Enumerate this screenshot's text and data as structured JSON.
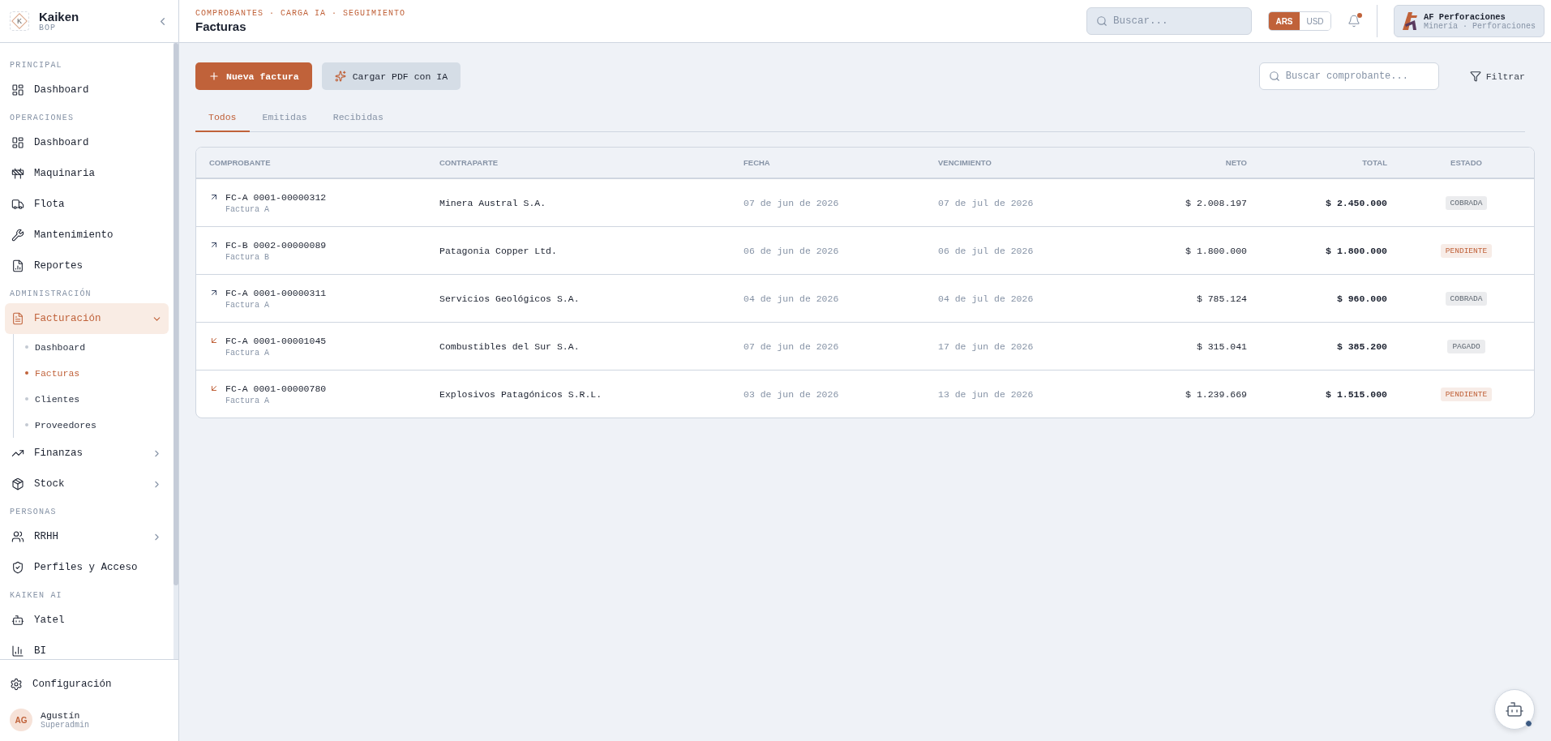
{
  "brand": {
    "logo_letter": "K",
    "name": "Kaiken",
    "subtitle": "BOP"
  },
  "sidebar": {
    "sections": [
      {
        "label": "PRINCIPAL",
        "items": [
          {
            "kind": "link",
            "label": "Dashboard",
            "selected": false
          }
        ]
      },
      {
        "label": "OPERACIONES",
        "items": [
          {
            "kind": "link",
            "label": "Dashboard",
            "selected": false
          },
          {
            "kind": "link",
            "label": "Maquinaria",
            "selected": false
          },
          {
            "kind": "link",
            "label": "Flota",
            "selected": false
          },
          {
            "kind": "link",
            "label": "Mantenimiento",
            "selected": false
          },
          {
            "kind": "link",
            "label": "Reportes",
            "selected": false
          }
        ]
      },
      {
        "label": "ADMINISTRACIÓN",
        "items": [
          {
            "kind": "group",
            "label": "Facturación",
            "selected": true,
            "expanded": true,
            "children": [
              {
                "label": "Dashboard",
                "selected": false
              },
              {
                "label": "Facturas",
                "selected": true
              },
              {
                "label": "Clientes",
                "selected": false
              },
              {
                "label": "Proveedores",
                "selected": false
              }
            ]
          },
          {
            "kind": "group",
            "label": "Finanzas",
            "selected": false,
            "expanded": false
          },
          {
            "kind": "group",
            "label": "Stock",
            "selected": false,
            "expanded": false
          }
        ]
      },
      {
        "label": "PERSONAS",
        "items": [
          {
            "kind": "group",
            "label": "RRHH",
            "selected": false,
            "expanded": false
          },
          {
            "kind": "link",
            "label": "Perfiles y Acceso",
            "selected": false
          }
        ]
      },
      {
        "label": "KAIKEN AI",
        "items": [
          {
            "kind": "link",
            "label": "Yatel",
            "selected": false
          },
          {
            "kind": "link",
            "label": "BI",
            "selected": false
          }
        ]
      }
    ],
    "settings": "Configuración",
    "user": {
      "initials": "AG",
      "name": "Agustín",
      "role": "Superadmin"
    }
  },
  "header": {
    "breadcrumb": "COMPROBANTES · CARGA IA · SEGUIMIENTO",
    "title": "Facturas",
    "search": {
      "placeholder": "Buscar..."
    },
    "currencies": [
      {
        "label": "ARS",
        "selected": true
      },
      {
        "label": "USD",
        "selected": false
      }
    ],
    "notifications": {
      "unread": true
    },
    "company": {
      "name": "AF Perforaciones",
      "sector": "Minería · Perforaciones"
    }
  },
  "toolbar": {
    "primary": "Nueva factura",
    "secondary": "Cargar PDF con IA",
    "search": {
      "placeholder": "Buscar comprobante..."
    },
    "filter": "Filtrar"
  },
  "tabs": [
    {
      "label": "Todos",
      "selected": true
    },
    {
      "label": "Emitidas",
      "selected": false
    },
    {
      "label": "Recibidas",
      "selected": false
    }
  ],
  "table": {
    "columns": [
      "COMPROBANTE",
      "CONTRAPARTE",
      "FECHA",
      "VENCIMIENTO",
      "NETO",
      "TOTAL",
      "ESTADO"
    ],
    "rows": [
      {
        "kind": "issued",
        "number": "FC-A 0001-00000312",
        "type": "Factura A",
        "counterpart": "Minera Austral S.A.",
        "date": "07 de jun de 2026",
        "due": "07 de jul de 2026",
        "net": "$ 2.008.197",
        "total": "$ 2.450.000",
        "status": {
          "label": "COBRADA",
          "color": "#5d6670"
        }
      },
      {
        "kind": "issued",
        "number": "FC-B 0002-00000089",
        "type": "Factura B",
        "counterpart": "Patagonia Copper Ltd.",
        "date": "06 de jun de 2026",
        "due": "06 de jul de 2026",
        "net": "$ 1.800.000",
        "total": "$ 1.800.000",
        "status": {
          "label": "PENDIENTE",
          "color": "#c0623a"
        }
      },
      {
        "kind": "issued",
        "number": "FC-A 0001-00000311",
        "type": "Factura A",
        "counterpart": "Servicios Geológicos S.A.",
        "date": "04 de jun de 2026",
        "due": "04 de jul de 2026",
        "net": "$ 785.124",
        "total": "$ 960.000",
        "status": {
          "label": "COBRADA",
          "color": "#5d6670"
        }
      },
      {
        "kind": "received",
        "number": "FC-A 0001-00001045",
        "type": "Factura A",
        "counterpart": "Combustibles del Sur S.A.",
        "date": "07 de jun de 2026",
        "due": "17 de jun de 2026",
        "net": "$ 315.041",
        "total": "$ 385.200",
        "status": {
          "label": "PAGADO",
          "color": "#5d6670"
        }
      },
      {
        "kind": "received",
        "number": "FC-A 0001-00000780",
        "type": "Factura A",
        "counterpart": "Explosivos Patagónicos S.R.L.",
        "date": "03 de jun de 2026",
        "due": "13 de jun de 2026",
        "net": "$ 1.239.669",
        "total": "$ 1.515.000",
        "status": {
          "label": "PENDIENTE",
          "color": "#c0623a"
        }
      }
    ]
  }
}
